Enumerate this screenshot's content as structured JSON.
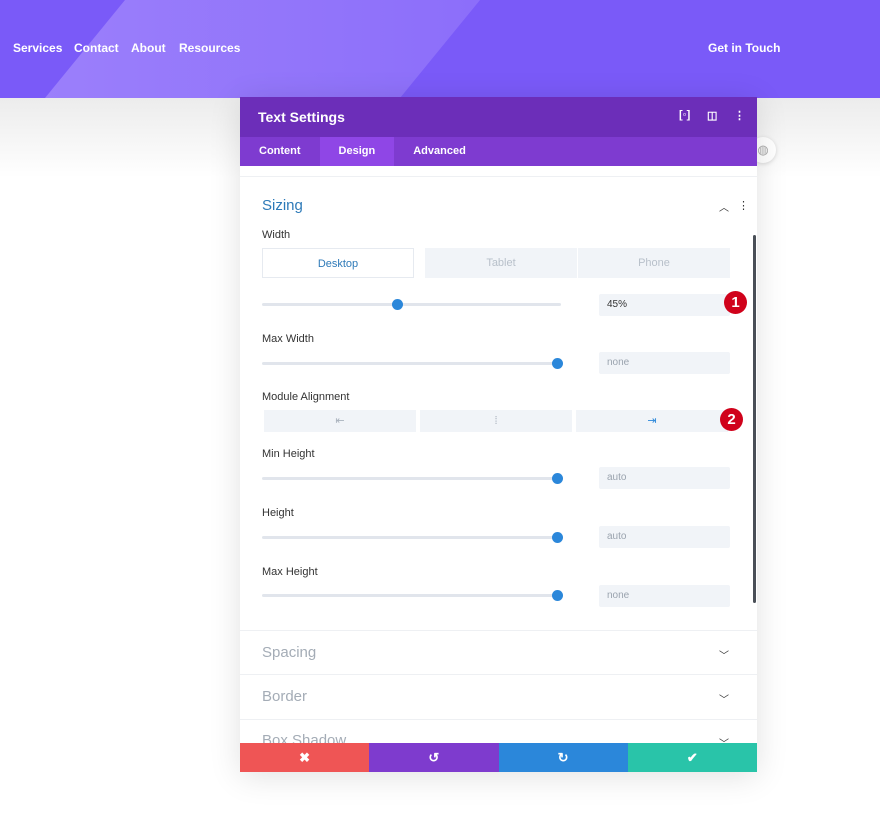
{
  "nav": {
    "items": [
      "Services",
      "Contact",
      "About",
      "Resources"
    ],
    "cta": "Get in Touch"
  },
  "panel": {
    "title": "Text Settings",
    "tabs": [
      "Content",
      "Design",
      "Advanced"
    ],
    "active_tab": "Design",
    "sizing": {
      "title": "Sizing",
      "width_label": "Width",
      "devices": [
        "Desktop",
        "Tablet",
        "Phone"
      ],
      "active_device": "Desktop",
      "width_value": "45%",
      "width_percent": 45,
      "max_width_label": "Max Width",
      "max_width_value": "none",
      "alignment_label": "Module Alignment",
      "alignment_selected": "right",
      "min_height_label": "Min Height",
      "min_height_value": "auto",
      "height_label": "Height",
      "height_value": "auto",
      "max_height_label": "Max Height",
      "max_height_value": "none"
    },
    "sections": [
      "Spacing",
      "Border",
      "Box Shadow"
    ],
    "badges": [
      "1",
      "2"
    ]
  },
  "colors": {
    "header": "#7a5af8",
    "panel_header": "#6c2eb9",
    "cancel": "#ef5555",
    "undo": "#7e3bce",
    "redo": "#2b87da",
    "save": "#29c4a9"
  }
}
